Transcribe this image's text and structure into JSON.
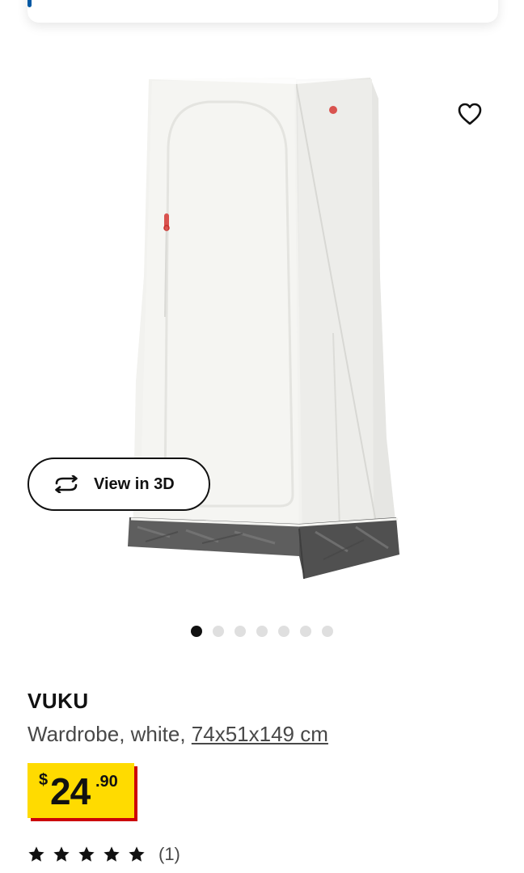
{
  "product": {
    "name": "VUKU",
    "description_prefix": "Wardrobe, white, ",
    "dimensions": "74x51x149 cm"
  },
  "price": {
    "currency": "$",
    "integer": "24",
    "decimal": ".90"
  },
  "rating": {
    "stars": 5,
    "count_label": "(1)"
  },
  "actions": {
    "view_3d_label": "View in 3D"
  },
  "gallery": {
    "total_images": 7,
    "active_index": 0
  },
  "colors": {
    "price_background": "#ffdb00",
    "price_shadow": "#cc0008",
    "accent_blue": "#0058a3"
  },
  "icons": {
    "favorite": "heart-outline-icon",
    "view_3d": "rotate-arrows-icon",
    "rating": "star-icon"
  }
}
